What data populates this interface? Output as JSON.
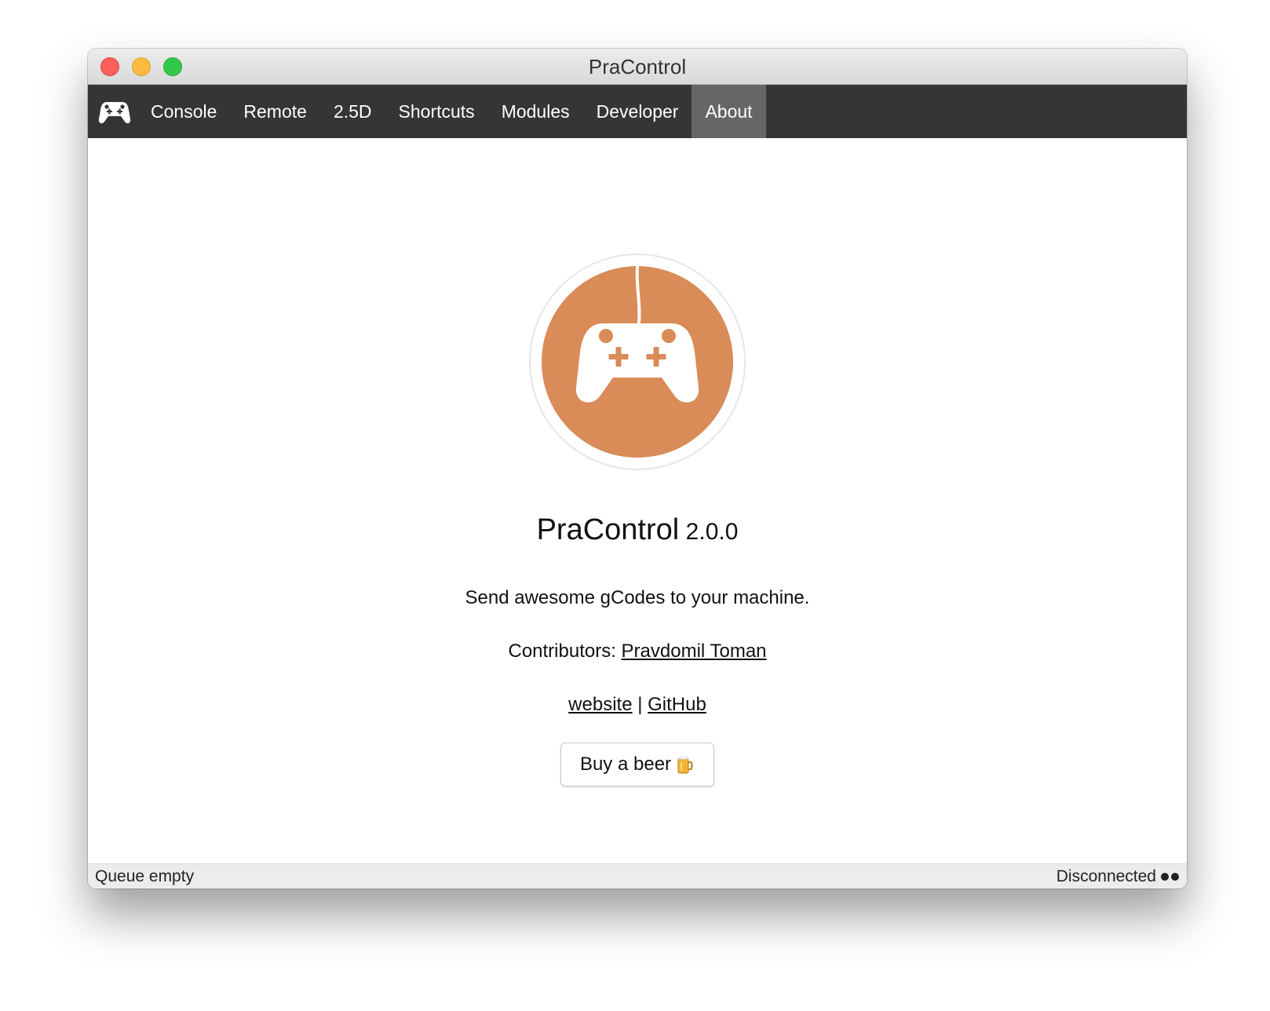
{
  "window": {
    "title": "PraControl"
  },
  "navbar": {
    "logo_icon": "gamepad-icon",
    "items": [
      {
        "label": "Console"
      },
      {
        "label": "Remote"
      },
      {
        "label": "2.5D"
      },
      {
        "label": "Shortcuts"
      },
      {
        "label": "Modules"
      },
      {
        "label": "Developer"
      },
      {
        "label": "About",
        "active": true
      }
    ]
  },
  "about": {
    "logo_icon": "gamepad-icon",
    "app_name": "PraControl",
    "version": "2.0.0",
    "tagline": "Send awesome gCodes to your machine.",
    "contributors_label": "Contributors:",
    "contributor_name": "Pravdomil Toman",
    "website_link": "website",
    "separator": "|",
    "github_link": "GitHub",
    "beer_button_label": "Buy a beer",
    "beer_icon": "beer-mug-icon"
  },
  "statusbar": {
    "queue_status": "Queue empty",
    "connection_status": "Disconnected"
  },
  "colors": {
    "brand_orange": "#d98b58",
    "navbar_bg": "#353535",
    "nav_active_bg": "#666666",
    "statusbar_bg": "#ececec"
  }
}
